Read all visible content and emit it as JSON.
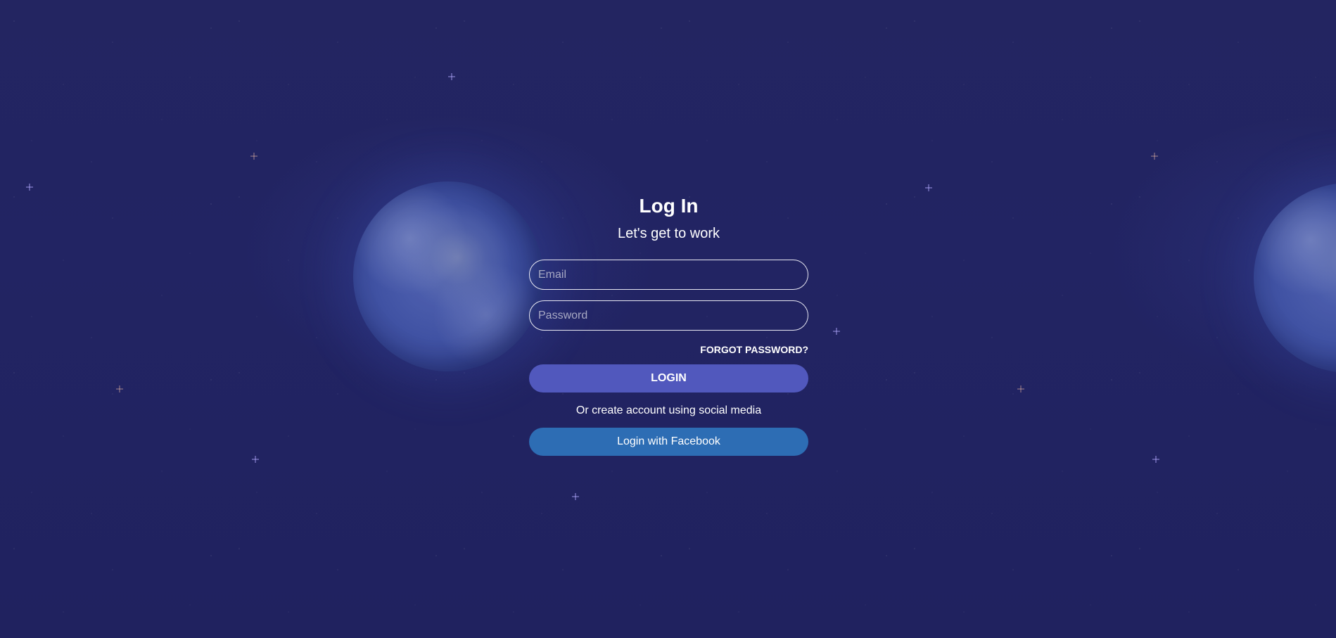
{
  "login": {
    "title": "Log In",
    "subtitle": "Let's get to work",
    "email_placeholder": "Email",
    "email_value": "",
    "password_placeholder": "Password",
    "password_value": "",
    "forgot_password_label": "FORGOT PASSWORD?",
    "login_button_label": "LOGIN",
    "social_text": "Or create account using social media",
    "facebook_button_label": "Login with Facebook"
  },
  "colors": {
    "background": "#222260",
    "login_button": "#5158bd",
    "facebook_button": "#2d6db4",
    "text": "#ffffff"
  },
  "background_icons": [
    "earth-globe-icon",
    "earth-globe-icon"
  ]
}
